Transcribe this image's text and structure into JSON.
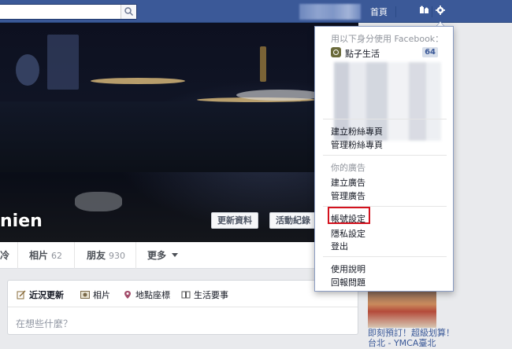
{
  "topbar": {
    "home_label": "首頁"
  },
  "cover": {
    "profile_name_partial": "nien",
    "update_button": "更新資料",
    "activity_button": "活動紀錄"
  },
  "profile_tabs": [
    {
      "label": "",
      "count": ""
    },
    {
      "label": "相片",
      "count": "62"
    },
    {
      "label": "朋友",
      "count": "930"
    },
    {
      "label": "更多",
      "count": ""
    }
  ],
  "profile_tab_partial": "冷",
  "composer": {
    "tabs": [
      "近況更新",
      "相片",
      "地點座標",
      "生活要事"
    ],
    "placeholder": "在想些什麼？"
  },
  "dropdown": {
    "use_as_heading": "用以下身分使用 Facebook：",
    "page_name": "點子生活",
    "page_badge": "64",
    "create_page": "建立粉絲專頁",
    "manage_pages": "管理粉絲專頁",
    "ads_heading": "你的廣告",
    "create_ads": "建立廣告",
    "manage_ads": "管理廣告",
    "account_settings": "帳號設定",
    "privacy_settings": "隱私設定",
    "log_out": "登出",
    "help": "使用說明",
    "report_problem": "回報問題"
  },
  "right_ad": {
    "text": "即刻預訂！超級划算！台北 - YMCA臺北"
  },
  "colors": {
    "topbar": "#3b5998",
    "highlight": "#d4121e",
    "link": "#3b5998"
  }
}
